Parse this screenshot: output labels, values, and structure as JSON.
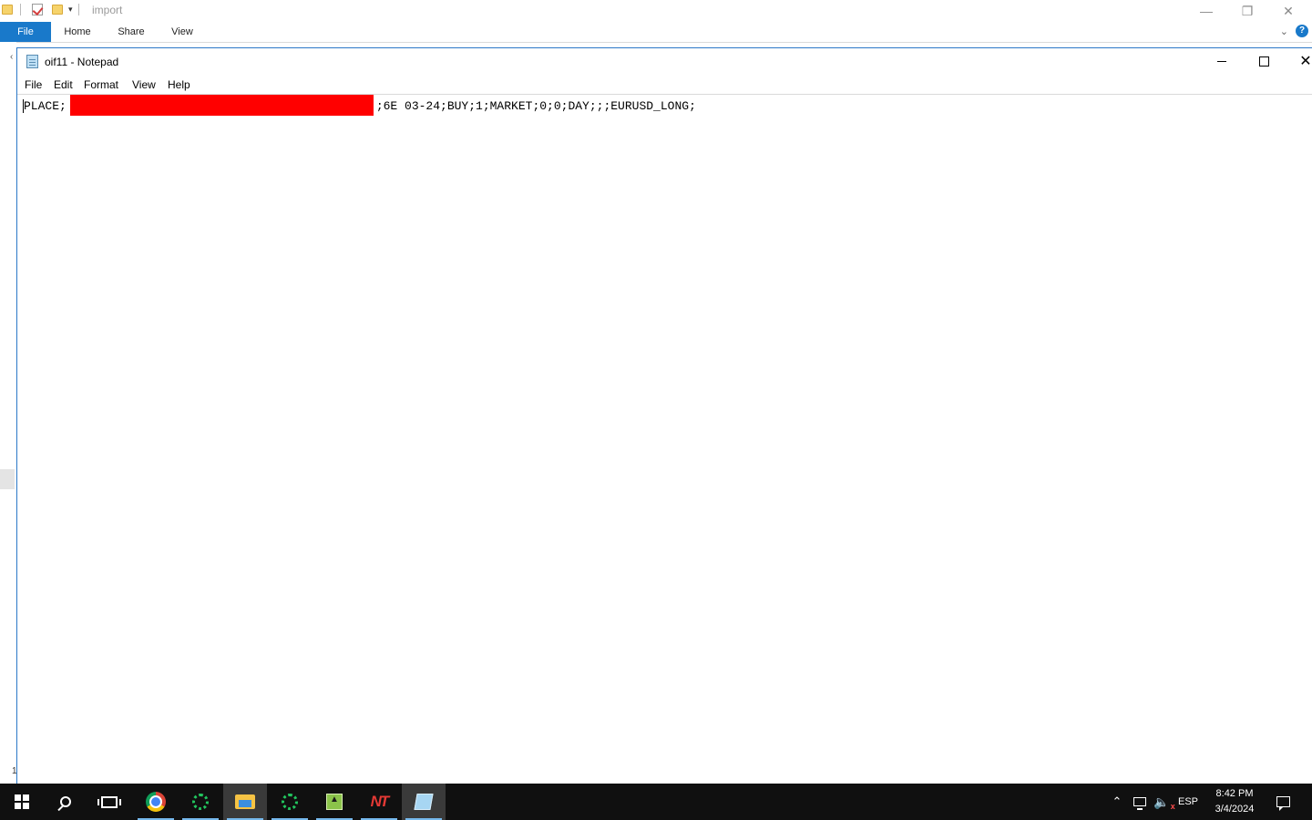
{
  "explorer": {
    "title": "import",
    "tabs": [
      "File",
      "Home",
      "Share",
      "View"
    ],
    "help_label": "?"
  },
  "notepad": {
    "title": "oif11 - Notepad",
    "menu": [
      "File",
      "Edit",
      "Format",
      "View",
      "Help"
    ],
    "content_prefix": "PLACE;",
    "content_suffix": ";6E 03-24;BUY;1;MARKET;0;0;DAY;;;EURUSD_LONG;",
    "redaction_color": "#ff0000"
  },
  "taskbar": {
    "apps": [
      "windows-start",
      "search",
      "task-view",
      "chrome",
      "green-ring-app",
      "file-explorer",
      "green-ring-app-2",
      "green-app",
      "ninjatrader",
      "notepad"
    ],
    "nt_label": "NT",
    "language": "ESP",
    "time": "8:42 PM",
    "date": "3/4/2024"
  },
  "colors": {
    "accent": "#1979ca",
    "taskbar": "#101010",
    "redaction": "#ff0000"
  }
}
